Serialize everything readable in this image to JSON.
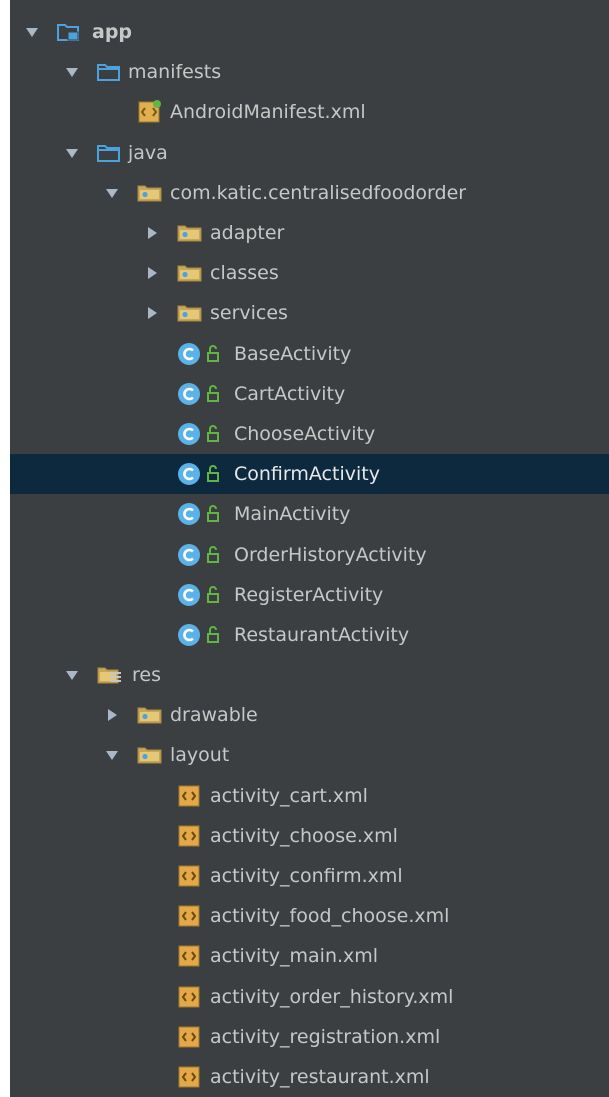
{
  "project_tree": {
    "items": [
      {
        "label": "app",
        "depth": 0,
        "expander": "expanded",
        "icon": "module-folder-icon",
        "bold": true
      },
      {
        "label": "manifests",
        "depth": 1,
        "expander": "expanded",
        "icon": "folder-icon"
      },
      {
        "label": "AndroidManifest.xml",
        "depth": 2,
        "expander": "none",
        "icon": "android-manifest-icon"
      },
      {
        "label": "java",
        "depth": 1,
        "expander": "expanded",
        "icon": "folder-icon"
      },
      {
        "label": "com.katic.centralisedfoodorder",
        "depth": 2,
        "expander": "expanded",
        "icon": "package-icon"
      },
      {
        "label": "adapter",
        "depth": 3,
        "expander": "collapsed",
        "icon": "package-icon"
      },
      {
        "label": "classes",
        "depth": 3,
        "expander": "collapsed",
        "icon": "package-icon"
      },
      {
        "label": "services",
        "depth": 3,
        "expander": "collapsed",
        "icon": "package-icon"
      },
      {
        "label": "BaseActivity",
        "depth": 3,
        "expander": "none",
        "icon": "class-icon"
      },
      {
        "label": "CartActivity",
        "depth": 3,
        "expander": "none",
        "icon": "class-icon"
      },
      {
        "label": "ChooseActivity",
        "depth": 3,
        "expander": "none",
        "icon": "class-icon"
      },
      {
        "label": "ConfirmActivity",
        "depth": 3,
        "expander": "none",
        "icon": "class-icon",
        "selected": true
      },
      {
        "label": "MainActivity",
        "depth": 3,
        "expander": "none",
        "icon": "class-icon"
      },
      {
        "label": "OrderHistoryActivity",
        "depth": 3,
        "expander": "none",
        "icon": "class-icon"
      },
      {
        "label": "RegisterActivity",
        "depth": 3,
        "expander": "none",
        "icon": "class-icon"
      },
      {
        "label": "RestaurantActivity",
        "depth": 3,
        "expander": "none",
        "icon": "class-icon"
      },
      {
        "label": "res",
        "depth": 1,
        "expander": "expanded",
        "icon": "resources-folder-icon"
      },
      {
        "label": "drawable",
        "depth": 2,
        "expander": "collapsed",
        "icon": "package-icon"
      },
      {
        "label": "layout",
        "depth": 2,
        "expander": "expanded",
        "icon": "package-icon"
      },
      {
        "label": "activity_cart.xml",
        "depth": 3,
        "expander": "none",
        "icon": "xml-file-icon"
      },
      {
        "label": "activity_choose.xml",
        "depth": 3,
        "expander": "none",
        "icon": "xml-file-icon"
      },
      {
        "label": "activity_confirm.xml",
        "depth": 3,
        "expander": "none",
        "icon": "xml-file-icon"
      },
      {
        "label": "activity_food_choose.xml",
        "depth": 3,
        "expander": "none",
        "icon": "xml-file-icon"
      },
      {
        "label": "activity_main.xml",
        "depth": 3,
        "expander": "none",
        "icon": "xml-file-icon"
      },
      {
        "label": "activity_order_history.xml",
        "depth": 3,
        "expander": "none",
        "icon": "xml-file-icon"
      },
      {
        "label": "activity_registration.xml",
        "depth": 3,
        "expander": "none",
        "icon": "xml-file-icon"
      },
      {
        "label": "activity_restaurant.xml",
        "depth": 3,
        "expander": "none",
        "icon": "xml-file-icon"
      }
    ]
  },
  "colors": {
    "panel_background": "#3c3f41",
    "selection_background": "#0d293e",
    "text": "#c5c8c6",
    "folder_blue": "#4aa3df",
    "class_circle": "#5ab2e8",
    "lock_green": "#62b543",
    "xml_orange": "#e3a84a"
  }
}
